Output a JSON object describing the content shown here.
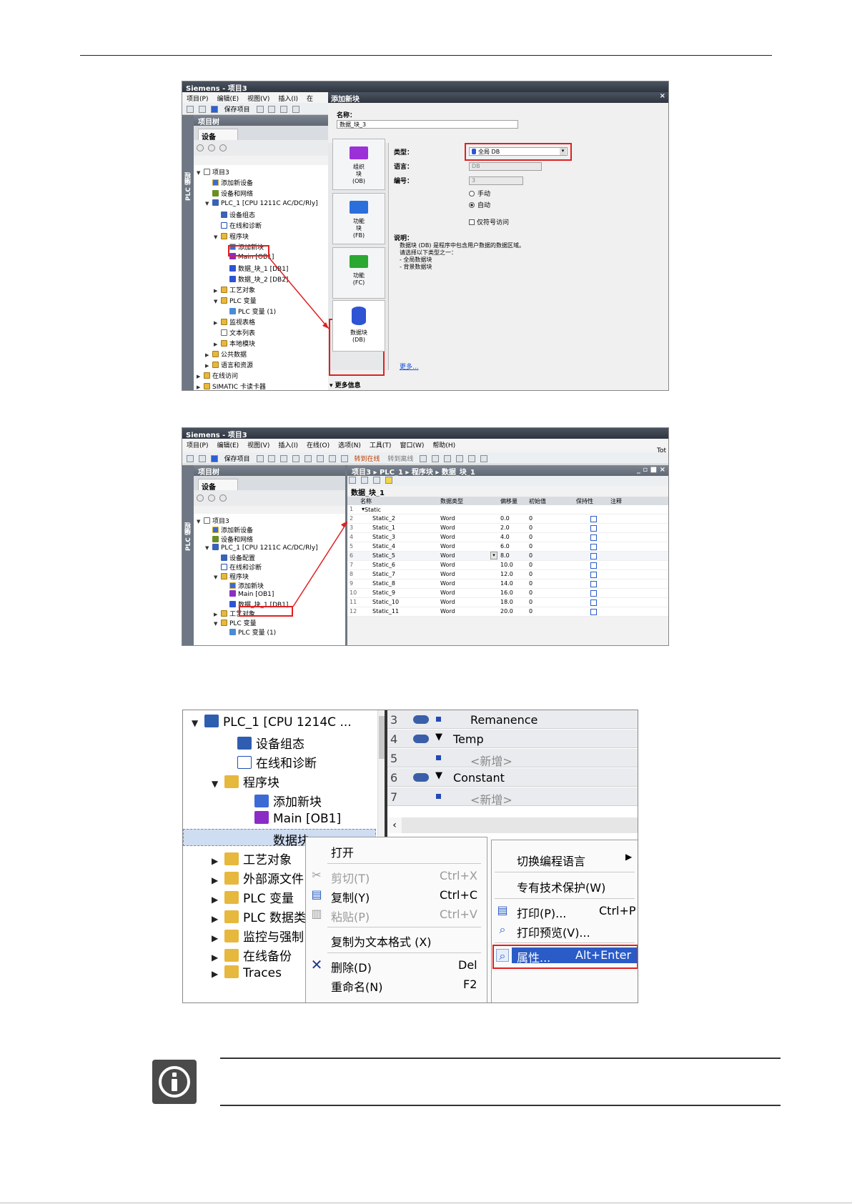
{
  "shot1": {
    "title": "Siemens  -  项目3",
    "menu": [
      "项目(P)",
      "编辑(E)",
      "视图(V)",
      "插入(I)",
      "在"
    ],
    "save_label": "保存项目",
    "project_tree_label": "项目树",
    "device_tab": "设备",
    "side_label": "PLC 编程",
    "tree": [
      {
        "label": "项目3",
        "indent": 0,
        "arrow": "▼",
        "icon": "ic-doc"
      },
      {
        "label": "添加新设备",
        "indent": 1,
        "arrow": "",
        "icon": "ic-star"
      },
      {
        "label": "设备和网络",
        "indent": 1,
        "arrow": "",
        "icon": "ic-net"
      },
      {
        "label": "PLC_1 [CPU 1211C AC/DC/Rly]",
        "indent": 1,
        "arrow": "▼",
        "icon": "ic-dev"
      },
      {
        "label": "设备组态",
        "indent": 2,
        "arrow": "",
        "icon": "ic-dev"
      },
      {
        "label": "在线和诊断",
        "indent": 2,
        "arrow": "",
        "icon": "ic-diag"
      },
      {
        "label": "程序块",
        "indent": 2,
        "arrow": "▼",
        "icon": "ic-folder"
      },
      {
        "label": "添加新块",
        "indent": 3,
        "arrow": "",
        "icon": "ic-star"
      },
      {
        "label": "Main [OB1]",
        "indent": 3,
        "arrow": "",
        "icon": "ic-ob"
      },
      {
        "label": "数据_块_1 [DB1]",
        "indent": 3,
        "arrow": "",
        "icon": "ic-cyl"
      },
      {
        "label": "数据_块_2 [DB2]",
        "indent": 3,
        "arrow": "",
        "icon": "ic-cyl"
      },
      {
        "label": "工艺对象",
        "indent": 2,
        "arrow": "▶",
        "icon": "ic-folder"
      },
      {
        "label": "PLC 变量",
        "indent": 2,
        "arrow": "▼",
        "icon": "ic-folder"
      },
      {
        "label": "PLC 变量 (1)",
        "indent": 3,
        "arrow": "",
        "icon": "ic-tag"
      },
      {
        "label": "监视表格",
        "indent": 2,
        "arrow": "▶",
        "icon": "ic-folder"
      },
      {
        "label": "文本列表",
        "indent": 2,
        "arrow": "",
        "icon": "ic-doc"
      },
      {
        "label": "本地模块",
        "indent": 2,
        "arrow": "▶",
        "icon": "ic-folder"
      },
      {
        "label": "公共数据",
        "indent": 1,
        "arrow": "▶",
        "icon": "ic-folder"
      },
      {
        "label": "语言和资源",
        "indent": 1,
        "arrow": "▶",
        "icon": "ic-folder"
      },
      {
        "label": "在线访问",
        "indent": 0,
        "arrow": "▶",
        "icon": "ic-folder"
      },
      {
        "label": "SIMATIC 卡读卡器",
        "indent": 0,
        "arrow": "▶",
        "icon": "ic-folder"
      }
    ],
    "dialog": {
      "title": "添加新块",
      "close": "×",
      "name_label": "名称：",
      "name_value": "数据_块_3",
      "blocks": [
        {
          "l1": "组织",
          "l2": "块",
          "l3": "(OB)",
          "color": "#9b30d9"
        },
        {
          "l1": "功能",
          "l2": "块",
          "l3": "(FB)",
          "color": "#2b6fdc"
        },
        {
          "l1": "功能",
          "l2": "",
          "l3": "(FC)",
          "color": "#2aa832"
        },
        {
          "l1": "数据块",
          "l2": "",
          "l3": "(DB)",
          "color": "#2e54d4"
        }
      ],
      "type_label": "类型：",
      "type_value": "全局 DB",
      "lang_label": "语言：",
      "lang_value": "DB",
      "num_label": "编号：",
      "num_value": "3",
      "manual": "手动",
      "auto": "自动",
      "optimized": "仅符号访问",
      "desc_label": "说明：",
      "desc_lines": [
        "数据块 (DB) 是程序中包含用户数据的数据区域。",
        "请选择以下类型之一：",
        "- 全局数据块",
        "- 背景数据块"
      ],
      "more_link": "更多...",
      "more_info": "▾ 更多信息"
    }
  },
  "shot2": {
    "title": "Siemens  -  项目3",
    "menu": [
      "项目(P)",
      "编辑(E)",
      "视图(V)",
      "插入(I)",
      "在线(O)",
      "选项(N)",
      "工具(T)",
      "窗口(W)",
      "帮助(H)"
    ],
    "save_label": "保存项目",
    "go_online": "转到在线",
    "go_offline": "转到离线",
    "right_edge": "Tot",
    "project_tree_label": "项目树",
    "device_tab": "设备",
    "side_label": "PLC 编程",
    "breadcrumb": "项目3  ▸  PLC_1  ▸  程序块  ▸  数据_块_1",
    "window_controls": "_ ▫ ■ ×",
    "tree": [
      {
        "label": "项目3",
        "indent": 0,
        "arrow": "▼",
        "icon": "ic-doc"
      },
      {
        "label": "添加新设备",
        "indent": 1,
        "arrow": "",
        "icon": "ic-star"
      },
      {
        "label": "设备和网络",
        "indent": 1,
        "arrow": "",
        "icon": "ic-net"
      },
      {
        "label": "PLC_1 [CPU 1211C AC/DC/Rly]",
        "indent": 1,
        "arrow": "▼",
        "icon": "ic-dev"
      },
      {
        "label": "设备配置",
        "indent": 2,
        "arrow": "",
        "icon": "ic-dev"
      },
      {
        "label": "在线和诊断",
        "indent": 2,
        "arrow": "",
        "icon": "ic-diag"
      },
      {
        "label": "程序块",
        "indent": 2,
        "arrow": "▼",
        "icon": "ic-folder"
      },
      {
        "label": "添加新块",
        "indent": 3,
        "arrow": "",
        "icon": "ic-star"
      },
      {
        "label": "Main [OB1]",
        "indent": 3,
        "arrow": "",
        "icon": "ic-ob"
      },
      {
        "label": "数据_块_1 [DB1]",
        "indent": 3,
        "arrow": "",
        "icon": "ic-cyl"
      },
      {
        "label": "工艺对象",
        "indent": 2,
        "arrow": "▶",
        "icon": "ic-folder"
      },
      {
        "label": "PLC 变量",
        "indent": 2,
        "arrow": "▼",
        "icon": "ic-folder"
      },
      {
        "label": "PLC 变量 (1)",
        "indent": 3,
        "arrow": "",
        "icon": "ic-tag"
      }
    ],
    "db_title": "数据_块_1",
    "columns": [
      "名称",
      "数据类型",
      "偏移量",
      "初始值",
      "保持性",
      "注释"
    ],
    "static_row": "Static",
    "rows": [
      {
        "n": "2",
        "name": "Static_2",
        "type": "Word",
        "off": "0.0",
        "init": "0"
      },
      {
        "n": "3",
        "name": "Static_1",
        "type": "Word",
        "off": "2.0",
        "init": "0"
      },
      {
        "n": "4",
        "name": "Static_3",
        "type": "Word",
        "off": "4.0",
        "init": "0"
      },
      {
        "n": "5",
        "name": "Static_4",
        "type": "Word",
        "off": "6.0",
        "init": "0"
      },
      {
        "n": "6",
        "name": "Static_5",
        "type": "Word",
        "off": "8.0",
        "init": "0"
      },
      {
        "n": "7",
        "name": "Static_6",
        "type": "Word",
        "off": "10.0",
        "init": "0"
      },
      {
        "n": "8",
        "name": "Static_7",
        "type": "Word",
        "off": "12.0",
        "init": "0"
      },
      {
        "n": "9",
        "name": "Static_8",
        "type": "Word",
        "off": "14.0",
        "init": "0"
      },
      {
        "n": "10",
        "name": "Static_9",
        "type": "Word",
        "off": "16.0",
        "init": "0"
      },
      {
        "n": "11",
        "name": "Static_10",
        "type": "Word",
        "off": "18.0",
        "init": "0"
      },
      {
        "n": "12",
        "name": "Static_11",
        "type": "Word",
        "off": "20.0",
        "init": "0"
      }
    ]
  },
  "shot3": {
    "tree": [
      {
        "label": "PLC_1 [CPU 1214C ...",
        "arrow": "▼",
        "level": 0,
        "icon": "#2f5db0"
      },
      {
        "label": "设备组态",
        "arrow": "",
        "level": 2,
        "icon": "#2f5db0"
      },
      {
        "label": "在线和诊断",
        "arrow": "",
        "level": 2,
        "icon": "#ffffff"
      },
      {
        "label": "程序块",
        "arrow": "▼",
        "level": 1,
        "icon": "#e7b83e"
      },
      {
        "label": "添加新块",
        "arrow": "",
        "level": 3,
        "icon": "#3c6bd6"
      },
      {
        "label": "Main [OB1]",
        "arrow": "",
        "level": 3,
        "icon": "#8b2cc6"
      },
      {
        "label": "数据块",
        "arrow": "",
        "level": 3,
        "icon": "#2e54d4"
      },
      {
        "label": "工艺对象",
        "arrow": "▶",
        "level": 1,
        "icon": "#e7b83e"
      },
      {
        "label": "外部源文件",
        "arrow": "▶",
        "level": 1,
        "icon": "#e7b83e"
      },
      {
        "label": "PLC 变量",
        "arrow": "▶",
        "level": 1,
        "icon": "#e7b83e"
      },
      {
        "label": "PLC 数据类",
        "arrow": "▶",
        "level": 1,
        "icon": "#e7b83e"
      },
      {
        "label": "监控与强制",
        "arrow": "▶",
        "level": 1,
        "icon": "#e7b83e"
      },
      {
        "label": "在线备份",
        "arrow": "▶",
        "level": 1,
        "icon": "#e7b83e"
      },
      {
        "label": "Traces",
        "arrow": "▶",
        "level": 1,
        "icon": "#e7b83e"
      }
    ],
    "rows": [
      {
        "n": "3",
        "kind": "io",
        "text": "Remanence",
        "mark": "sq"
      },
      {
        "n": "4",
        "kind": "io",
        "text": "Temp",
        "mark": "tri"
      },
      {
        "n": "5",
        "kind": "",
        "text": "<新增>",
        "mark": "sq"
      },
      {
        "n": "6",
        "kind": "io",
        "text": "Constant",
        "mark": "tri"
      },
      {
        "n": "7",
        "kind": "",
        "text": "<新增>",
        "mark": "sq"
      }
    ],
    "menu1": {
      "open": "打开",
      "cut": "剪切(T)",
      "cut_key": "Ctrl+X",
      "copy": "复制(Y)",
      "copy_key": "Ctrl+C",
      "paste": "粘贴(P)",
      "paste_key": "Ctrl+V",
      "copy_text": "复制为文本格式 (X)",
      "delete": "删除(D)",
      "delete_key": "Del",
      "rename": "重命名(N)",
      "rename_key": "F2"
    },
    "menu2": {
      "switch_lang": "切换编程语言",
      "know_how": "专有技术保护(W)",
      "print": "打印(P)...",
      "print_key": "Ctrl+P",
      "preview": "打印预览(V)...",
      "properties": "属性...",
      "properties_key": "Alt+Enter"
    }
  }
}
